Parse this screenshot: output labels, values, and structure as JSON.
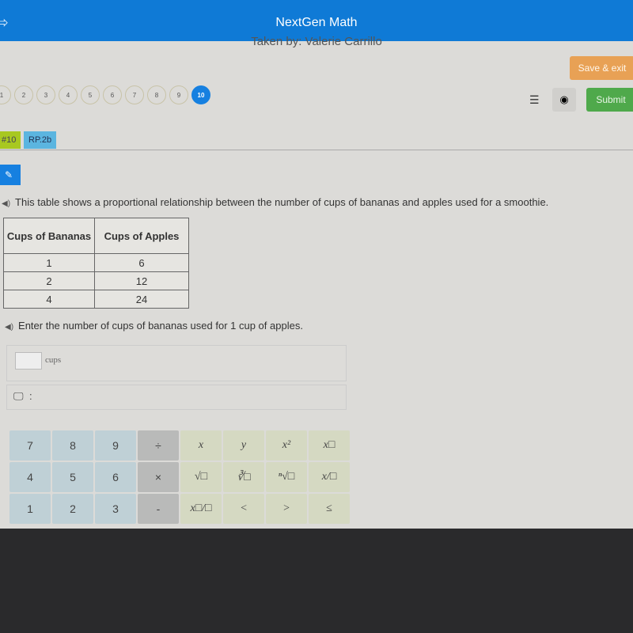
{
  "header": {
    "title": "NextGen Math",
    "taken_by": "Taken by: Valerie Carrillo"
  },
  "buttons": {
    "save_exit": "Save & exit",
    "submit": "Submit"
  },
  "question_nav": [
    "1",
    "2",
    "3",
    "4",
    "5",
    "6",
    "7",
    "8",
    "9",
    "10"
  ],
  "current_question": "10",
  "tags": [
    "#10",
    "RP.2b"
  ],
  "question": {
    "prompt": "This table shows a proportional relationship between the number of cups of bananas and apples used for a smoothie.",
    "instruction": "Enter the number of cups of bananas used for 1 cup of apples.",
    "answer_value": "",
    "unit": "cups"
  },
  "table": {
    "headers": [
      "Cups of Bananas",
      "Cups of Apples"
    ],
    "rows": [
      [
        "1",
        "6"
      ],
      [
        "2",
        "12"
      ],
      [
        "4",
        "24"
      ]
    ]
  },
  "keypad": {
    "header": ":",
    "keys": [
      "7",
      "8",
      "9",
      "÷",
      "x",
      "y",
      "x²",
      "x□",
      "4",
      "5",
      "6",
      "×",
      "√□",
      "∛□",
      "ⁿ√□",
      "x/□",
      "1",
      "2",
      "3",
      "-",
      "x□/□",
      "<",
      ">",
      "≤"
    ]
  }
}
